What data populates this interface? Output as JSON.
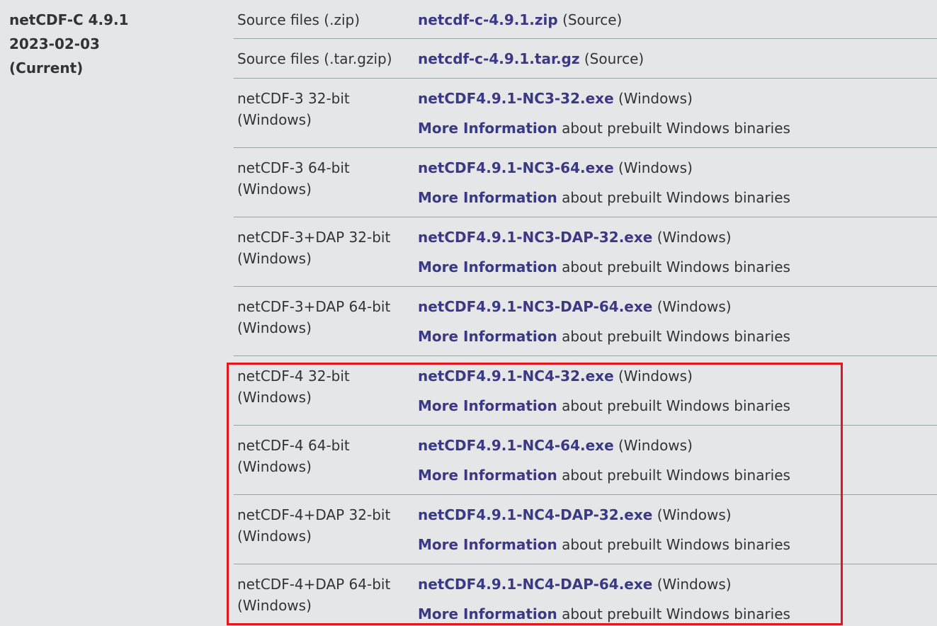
{
  "release": {
    "name": "netCDF-C 4.9.1",
    "date": "2023-02-03",
    "status": "(Current)"
  },
  "rows": [
    {
      "label1": "Source files (.zip)",
      "label2": "",
      "file": "netcdf-c-4.9.1.zip",
      "file_suffix": "(Source)"
    },
    {
      "label1": "Source files (.tar.gzip)",
      "label2": "",
      "file": "netcdf-c-4.9.1.tar.gz",
      "file_suffix": "(Source)"
    },
    {
      "label1": "netCDF-3 32-bit",
      "label2": "(Windows)",
      "file": "netCDF4.9.1-NC3-32.exe",
      "file_suffix": "(Windows)",
      "info_link": "More Information",
      "info_text": "about prebuilt Windows binaries"
    },
    {
      "label1": "netCDF-3 64-bit",
      "label2": "(Windows)",
      "file": "netCDF4.9.1-NC3-64.exe",
      "file_suffix": "(Windows)",
      "info_link": "More Information",
      "info_text": "about prebuilt Windows binaries"
    },
    {
      "label1": "netCDF-3+DAP 32-bit",
      "label2": "(Windows)",
      "file": "netCDF4.9.1-NC3-DAP-32.exe",
      "file_suffix": "(Windows)",
      "info_link": "More Information",
      "info_text": "about prebuilt Windows binaries"
    },
    {
      "label1": "netCDF-3+DAP 64-bit",
      "label2": "(Windows)",
      "file": "netCDF4.9.1-NC3-DAP-64.exe",
      "file_suffix": "(Windows)",
      "info_link": "More Information",
      "info_text": "about prebuilt Windows binaries"
    },
    {
      "label1": "netCDF-4 32-bit",
      "label2": "(Windows)",
      "file": "netCDF4.9.1-NC4-32.exe",
      "file_suffix": "(Windows)",
      "info_link": "More Information",
      "info_text": "about prebuilt Windows binaries"
    },
    {
      "label1": "netCDF-4 64-bit",
      "label2": "(Windows)",
      "file": "netCDF4.9.1-NC4-64.exe",
      "file_suffix": "(Windows)",
      "info_link": "More Information",
      "info_text": "about prebuilt Windows binaries"
    },
    {
      "label1": "netCDF-4+DAP 32-bit",
      "label2": "(Windows)",
      "file": "netCDF4.9.1-NC4-DAP-32.exe",
      "file_suffix": "(Windows)",
      "info_link": "More Information",
      "info_text": "about prebuilt Windows binaries"
    },
    {
      "label1": "netCDF-4+DAP 64-bit",
      "label2": "(Windows)",
      "file": "netCDF4.9.1-NC4-DAP-64.exe",
      "file_suffix": "(Windows)",
      "info_link": "More Information",
      "info_text": "about prebuilt Windows binaries"
    }
  ],
  "colors": {
    "background": "#e5e6e7",
    "link": "#3b3985",
    "text": "#333333",
    "highlight": "#e8141b"
  }
}
